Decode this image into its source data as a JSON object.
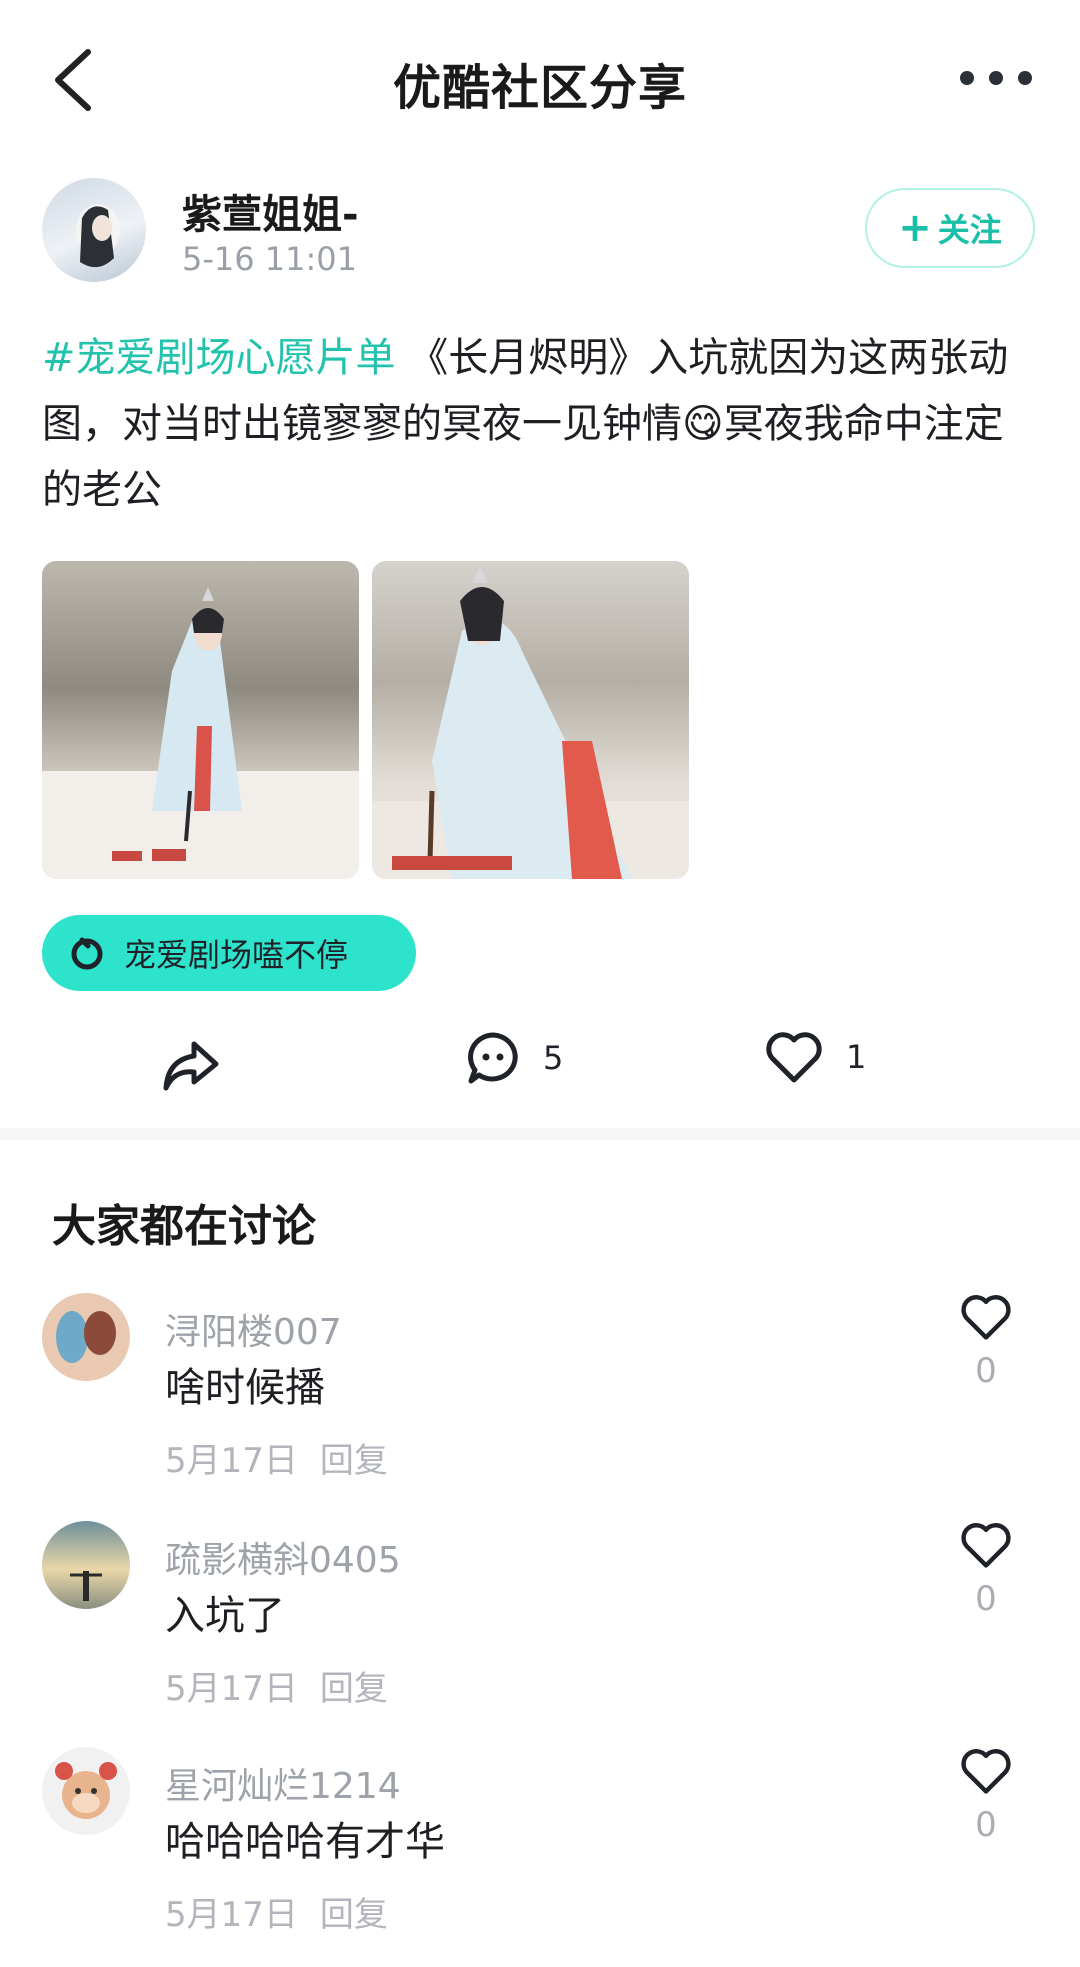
{
  "header": {
    "title": "优酷社区分享"
  },
  "author": {
    "name": "紫萱姐姐-",
    "time": "5-16 11:01",
    "follow_label": "关注"
  },
  "post": {
    "topic": "#宠爱剧场心愿片单",
    "text_line1": " 《长月烬明》入坑就因为这两张动图，对当时出镜寥寥的冥夜一见钟情",
    "emoji": "😋",
    "text_line2": "冥夜我命中注定的老公"
  },
  "circle": {
    "label": "宠爱剧场嗑不停"
  },
  "actions": {
    "comment_count": "5",
    "like_count": "1"
  },
  "discussion": {
    "title": "大家都在讨论",
    "comments": [
      {
        "user": "浔阳楼007",
        "text": "啥时候播",
        "date": "5月17日",
        "reply": "回复",
        "likes": "0"
      },
      {
        "user": "疏影横斜0405",
        "text": "入坑了",
        "date": "5月17日",
        "reply": "回复",
        "likes": "0"
      },
      {
        "user": "星河灿烂1214",
        "text": "哈哈哈哈有才华",
        "date": "5月17日",
        "reply": "回复",
        "likes": "0"
      }
    ]
  },
  "colors": {
    "accent": "#22c3ad",
    "tag_bg": "#2ee3cc"
  }
}
